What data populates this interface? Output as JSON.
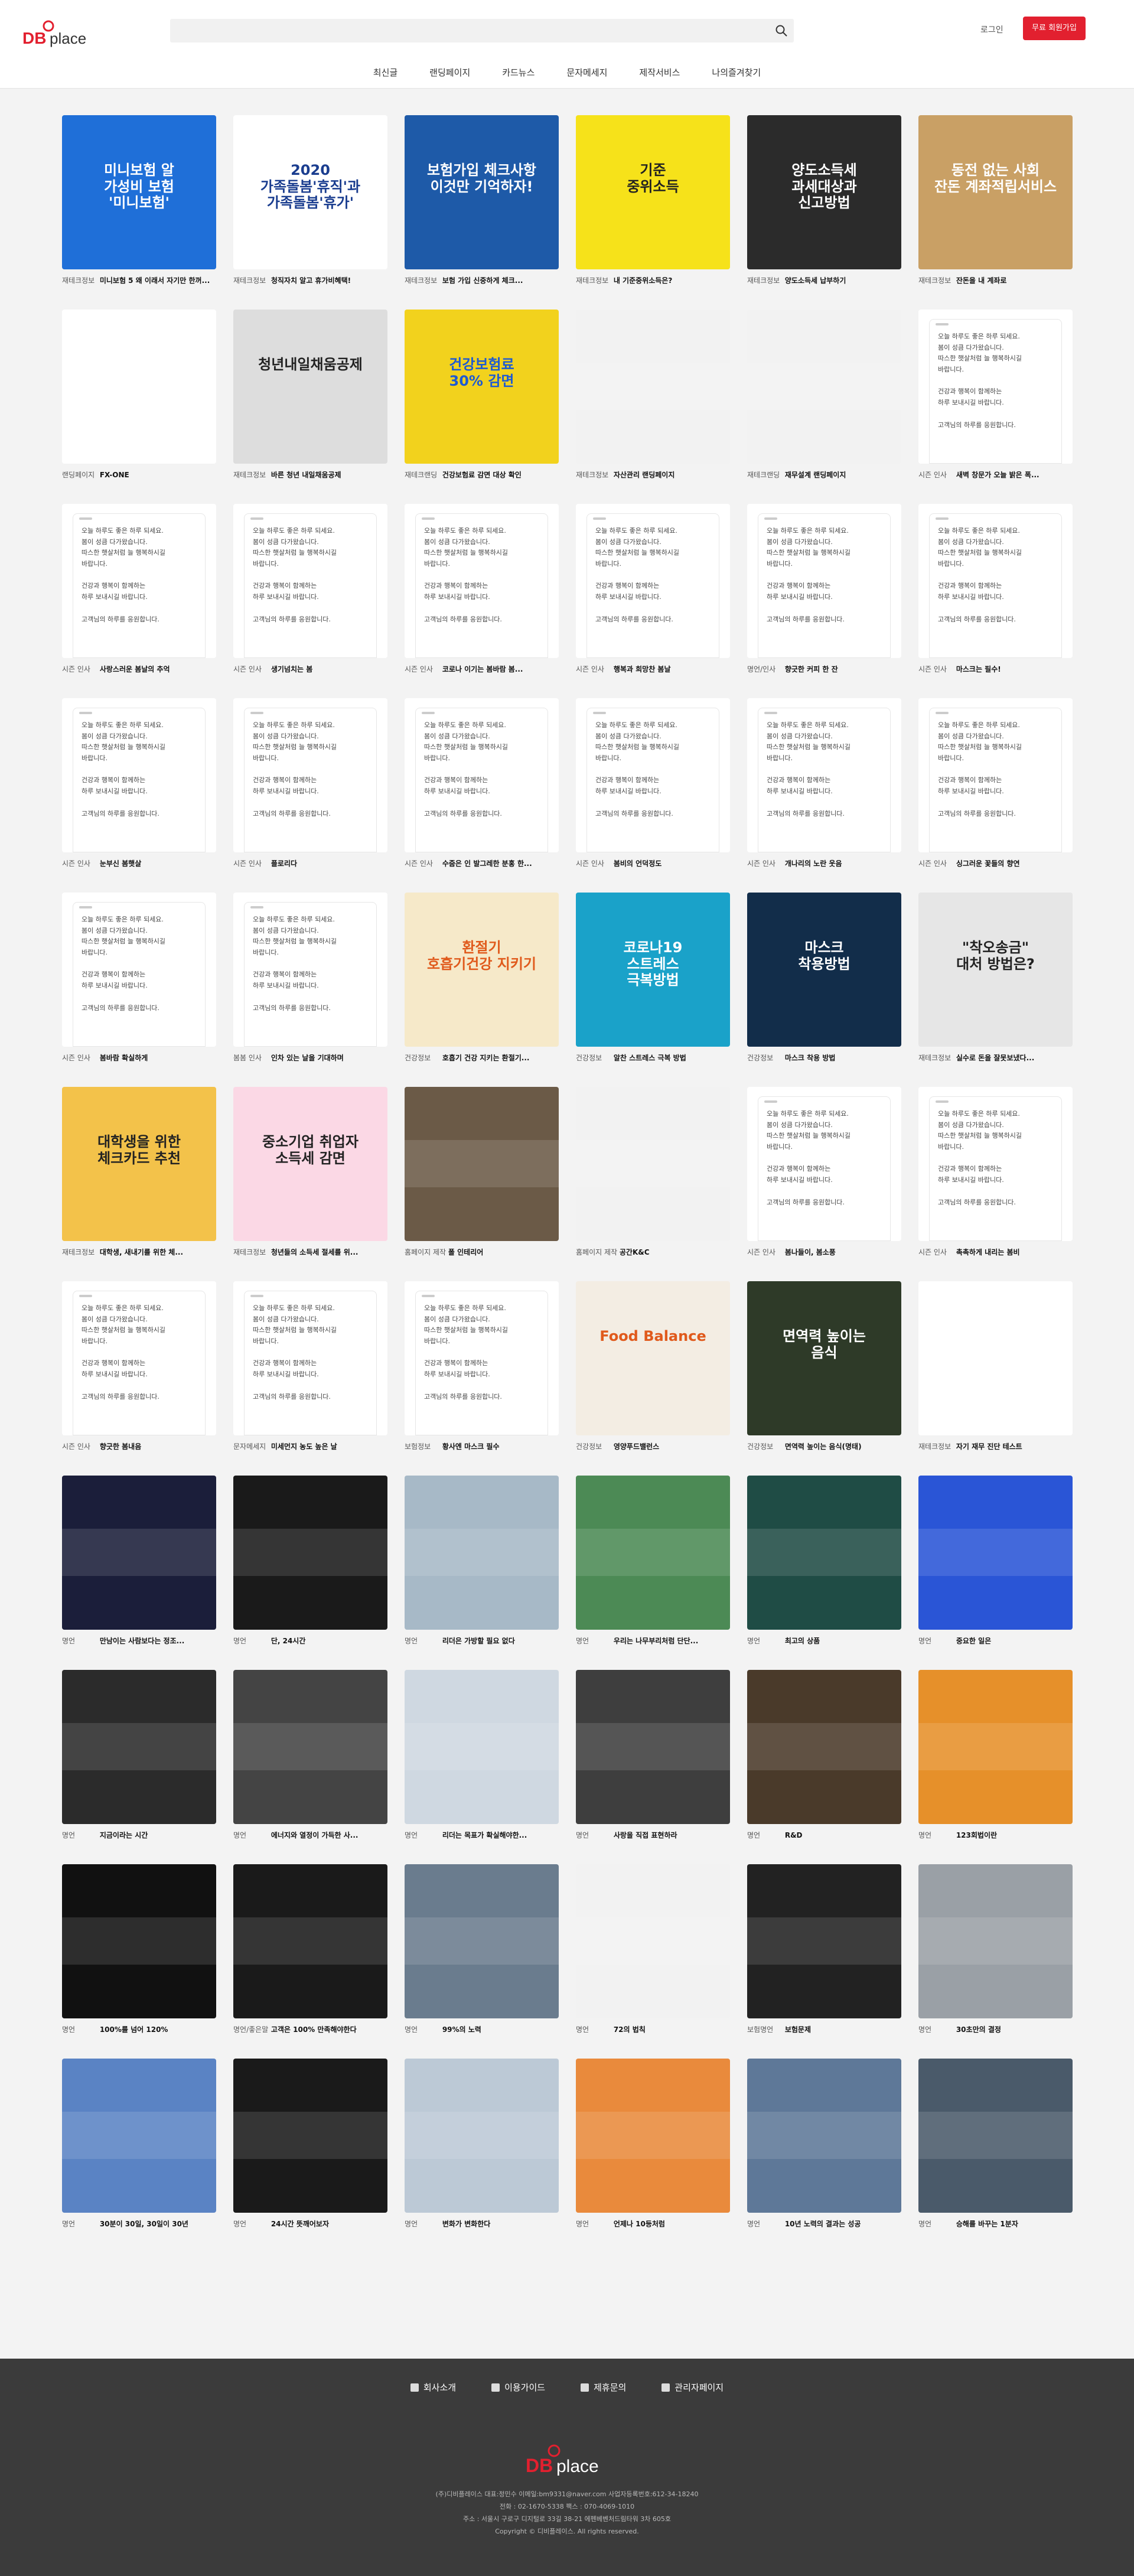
{
  "brand": {
    "logo_db": "DB",
    "logo_place": "place",
    "accent": "#e2202f"
  },
  "search": {
    "placeholder": "",
    "icon": "search-icon"
  },
  "auth": {
    "login": "로그인",
    "join": "무료 회원가입"
  },
  "nav": [
    "최신글",
    "랜딩페이지",
    "카드뉴스",
    "문자메세지",
    "제작서비스",
    "나의즐겨찾기"
  ],
  "cards": [
    {
      "cat": "재테크정보",
      "title": "미니보험 5 왜 이래서 자기만 한꺼...",
      "bg": "#1f6fd8",
      "text": "미니보험 알\n가성비 보험\n'미니보험'",
      "fg": "#fff"
    },
    {
      "cat": "재테크정보",
      "title": "청직자치 알고 휴가비혜택!",
      "bg": "#ffffff",
      "text": "2020\n가족돌봄'휴직'과\n가족돌봄'휴가'",
      "fg": "#1a3d8f"
    },
    {
      "cat": "재테크정보",
      "title": "보험 가입 신중하게 체크...",
      "bg": "#1e5aa8",
      "text": "보험가입 체크사항\n이것만 기억하자!",
      "fg": "#fff"
    },
    {
      "cat": "재테크정보",
      "title": "내 기준중위소득은?",
      "bg": "#f6e21a",
      "text": "기준\n중위소득",
      "fg": "#222"
    },
    {
      "cat": "재테크정보",
      "title": "양도소득세 납부하기",
      "bg": "#2b2b2b",
      "text": "양도소득세\n과세대상과\n신고방법",
      "fg": "#fff"
    },
    {
      "cat": "재테크정보",
      "title": "잔돈을 내 계좌로",
      "bg": "#c9a065",
      "text": "동전 없는 사회\n잔돈 계좌적립서비스",
      "fg": "#fff"
    },
    {
      "cat": "랜딩페이지",
      "title": "FX-ONE",
      "bg": "#ffffff",
      "text": "",
      "fg": "#222"
    },
    {
      "cat": "재테크정보",
      "title": "바른 청년 내일채움공제",
      "bg": "#dddddd",
      "text": "청년내일채움공제",
      "fg": "#222"
    },
    {
      "cat": "재테크랜딩",
      "title": "건강보험료 감면 대상 확인",
      "bg": "#f2d21d",
      "text": "건강보험료\n30% 감면",
      "fg": "#1d5ad3"
    },
    {
      "cat": "재테크정보",
      "title": "자산관리 랜딩페이지",
      "bg": "#f2f2f2",
      "text": "",
      "fg": "#222"
    },
    {
      "cat": "재테크랜딩",
      "title": "재무설계 랜딩페이지",
      "bg": "#f2f2f2",
      "text": "",
      "fg": "#222"
    },
    {
      "cat": "시즌 인사",
      "title": "새벽 창문가 오늘 밝은 폭...",
      "bg": "#ffffff",
      "text": "phone",
      "fg": "#222"
    },
    {
      "cat": "시즌 인사",
      "title": "사랑스러운 봄날의 추억",
      "bg": "#ffffff",
      "text": "phone",
      "fg": "#222"
    },
    {
      "cat": "시즌 인사",
      "title": "생기넘치는 봄",
      "bg": "#ffffff",
      "text": "phone",
      "fg": "#222"
    },
    {
      "cat": "시즌 인사",
      "title": "코로나 이기는 봄바람 봄...",
      "bg": "#ffffff",
      "text": "phone",
      "fg": "#222"
    },
    {
      "cat": "시즌 인사",
      "title": "행복과 희망찬 봄날",
      "bg": "#ffffff",
      "text": "phone",
      "fg": "#222"
    },
    {
      "cat": "명언/인사",
      "title": "향긋한 커피 한 잔",
      "bg": "#ffffff",
      "text": "phone",
      "fg": "#222"
    },
    {
      "cat": "시즌 인사",
      "title": "마스크는 필수!",
      "bg": "#ffffff",
      "text": "phone",
      "fg": "#222"
    },
    {
      "cat": "시즌 인사",
      "title": "눈부신 봄햇살",
      "bg": "#ffffff",
      "text": "phone",
      "fg": "#222"
    },
    {
      "cat": "시즌 인사",
      "title": "플로리다",
      "bg": "#ffffff",
      "text": "phone",
      "fg": "#222"
    },
    {
      "cat": "시즌 인사",
      "title": "수줍은 인 발그레한 분홍 한...",
      "bg": "#ffffff",
      "text": "phone",
      "fg": "#222"
    },
    {
      "cat": "시즌 인사",
      "title": "봄비의 언덕정도",
      "bg": "#ffffff",
      "text": "phone",
      "fg": "#222"
    },
    {
      "cat": "시즌 인사",
      "title": "개나리의 노란 웃음",
      "bg": "#ffffff",
      "text": "phone",
      "fg": "#222"
    },
    {
      "cat": "시즌 인사",
      "title": "싱그러운 꽃들의 향연",
      "bg": "#ffffff",
      "text": "phone",
      "fg": "#222"
    },
    {
      "cat": "시즌 인사",
      "title": "봄바람 확실하게",
      "bg": "#ffffff",
      "text": "phone",
      "fg": "#222"
    },
    {
      "cat": "봄봄 인사",
      "title": "인차 있는 날을 기대하며",
      "bg": "#ffffff",
      "text": "phone",
      "fg": "#222"
    },
    {
      "cat": "건강정보",
      "title": "호흡기 건강 지키는 환절기...",
      "bg": "#f6e9c9",
      "text": "환절기\n호흡기건강 지키기",
      "fg": "#e05a1c"
    },
    {
      "cat": "건강정보",
      "title": "알찬 스트레스 극복 방법",
      "bg": "#1aa2c9",
      "text": "코로나19\n스트레스\n극복방법",
      "fg": "#fff"
    },
    {
      "cat": "건강정보",
      "title": "마스크 착용 방법",
      "bg": "#122d4a",
      "text": "마스크\n착용방법",
      "fg": "#fff"
    },
    {
      "cat": "재테크정보",
      "title": "실수로 돈을 잘못보냈다...",
      "bg": "#e6e6e6",
      "text": "\"착오송금\"\n대처 방법은?",
      "fg": "#222"
    },
    {
      "cat": "재테크정보",
      "title": "대학생, 새내기를 위한 체...",
      "bg": "#f3c24a",
      "text": "대학생을 위한\n체크카드 추천",
      "fg": "#222"
    },
    {
      "cat": "재테크정보",
      "title": "청년들의 소득세 절세를 위...",
      "bg": "#fbd8e5",
      "text": "중소기업 취업자\n소득세 감면",
      "fg": "#222"
    },
    {
      "cat": "홈페이지 제작",
      "title": "폴 인테리어",
      "bg": "#6b5a47",
      "text": "",
      "fg": "#fff"
    },
    {
      "cat": "홈페이지 제작",
      "title": "공간K&C",
      "bg": "#f2f2f2",
      "text": "",
      "fg": "#222"
    },
    {
      "cat": "시즌 인사",
      "title": "봄나들이, 봄소풍",
      "bg": "#ffffff",
      "text": "phone",
      "fg": "#222"
    },
    {
      "cat": "시즌 인사",
      "title": "촉촉하게 내리는 봄비",
      "bg": "#ffffff",
      "text": "phone",
      "fg": "#222"
    },
    {
      "cat": "시즌 인사",
      "title": "향긋한 봄내음",
      "bg": "#ffffff",
      "text": "phone",
      "fg": "#222"
    },
    {
      "cat": "문자메세지",
      "title": "미세먼지 농도 높은 날",
      "bg": "#ffffff",
      "text": "phone",
      "fg": "#222"
    },
    {
      "cat": "보험정보",
      "title": "황사엔 마스크 필수",
      "bg": "#ffffff",
      "text": "phone",
      "fg": "#222"
    },
    {
      "cat": "건강정보",
      "title": "영양푸드밸런스",
      "bg": "#f3ede3",
      "text": "Food Balance",
      "fg": "#e05a1c"
    },
    {
      "cat": "건강정보",
      "title": "면역력 높이는 음식(명태)",
      "bg": "#2e3a28",
      "text": "면역력 높이는\n음식",
      "fg": "#fff"
    },
    {
      "cat": "재테크정보",
      "title": "자기 재무 진단 테스트",
      "bg": "#ffffff",
      "text": "",
      "fg": "#222"
    },
    {
      "cat": "명언",
      "title": "만남이는 사람보다는 정조...",
      "bg": "#1b1e3a",
      "text": "",
      "fg": "#fff"
    },
    {
      "cat": "명언",
      "title": "단, 24시간",
      "bg": "#1a1a1a",
      "text": "",
      "fg": "#fff"
    },
    {
      "cat": "명언",
      "title": "리더은 가방할 필요 없다",
      "bg": "#a7b9c7",
      "text": "",
      "fg": "#fff"
    },
    {
      "cat": "명언",
      "title": "우리는 나무부리처럼 단단...",
      "bg": "#4c8a55",
      "text": "",
      "fg": "#fff"
    },
    {
      "cat": "명언",
      "title": "최고의 상품",
      "bg": "#1f4c45",
      "text": "",
      "fg": "#fff"
    },
    {
      "cat": "명언",
      "title": "중요한 일은",
      "bg": "#2a55d6",
      "text": "",
      "fg": "#fff"
    },
    {
      "cat": "명언",
      "title": "지금이라는 시간",
      "bg": "#2b2b2b",
      "text": "",
      "fg": "#fff"
    },
    {
      "cat": "명언",
      "title": "에너지와 열정이 가득한 사...",
      "bg": "#444444",
      "text": "",
      "fg": "#fff"
    },
    {
      "cat": "명언",
      "title": "리더는 목표가 확실해야한...",
      "bg": "#cfd8e1",
      "text": "",
      "fg": "#fff"
    },
    {
      "cat": "명언",
      "title": "사랑을 직접 표현하라",
      "bg": "#3e3e3e",
      "text": "",
      "fg": "#fff"
    },
    {
      "cat": "명언",
      "title": "R&D",
      "bg": "#4a3a2a",
      "text": "",
      "fg": "#fff"
    },
    {
      "cat": "명언",
      "title": "123회법이란",
      "bg": "#e6902a",
      "text": "",
      "fg": "#fff"
    },
    {
      "cat": "명언",
      "title": "100%를 넘어 120%",
      "bg": "#111111",
      "text": "",
      "fg": "#fff"
    },
    {
      "cat": "명언/좋은말",
      "title": "고객은 100% 만족해야한다",
      "bg": "#1a1a1a",
      "text": "",
      "fg": "#fff"
    },
    {
      "cat": "명언",
      "title": "99%의 노력",
      "bg": "#6a7c8e",
      "text": "",
      "fg": "#fff"
    },
    {
      "cat": "명언",
      "title": "72의 법칙",
      "bg": "#f2f2f2",
      "text": "",
      "fg": "#222"
    },
    {
      "cat": "보험명언",
      "title": "보험문제",
      "bg": "#222222",
      "text": "",
      "fg": "#fff"
    },
    {
      "cat": "명언",
      "title": "30초만의 결정",
      "bg": "#9aa0a6",
      "text": "",
      "fg": "#fff"
    },
    {
      "cat": "명언",
      "title": "30분이 30일, 30일이 30년",
      "bg": "#5a83c4",
      "text": "",
      "fg": "#fff"
    },
    {
      "cat": "명언",
      "title": "24시간 뜻깨어보자",
      "bg": "#1a1a1a",
      "text": "",
      "fg": "#fff"
    },
    {
      "cat": "명언",
      "title": "변화가 변화한다",
      "bg": "#bcc9d6",
      "text": "",
      "fg": "#fff"
    },
    {
      "cat": "명언",
      "title": "언제나 10등처럼",
      "bg": "#e98a3c",
      "text": "",
      "fg": "#fff"
    },
    {
      "cat": "명언",
      "title": "10년 노력의 결과는 성공",
      "bg": "#5e7898",
      "text": "",
      "fg": "#fff"
    },
    {
      "cat": "명언",
      "title": "승해를 바꾸는 1분자",
      "bg": "#4a5a6a",
      "text": "",
      "fg": "#fff"
    }
  ],
  "phone_text": "오늘 하루도 좋은 하루 되세요.\n봄이 성큼 다가왔습니다.\n따스한 햇살처럼 늘 행복하시길\n바랍니다.\n\n건강과 행복이 함께하는\n하루 보내시길 바랍니다.\n\n고객님의 하루를 응원합니다.",
  "footer": {
    "links": [
      "회사소개",
      "이용가이드",
      "제휴문의",
      "관리자페이지"
    ],
    "info": [
      "(주)디비플레이스 대표:정민수 이메일:bm9331@naver.com 사업자등록번호:612-34-18240",
      "전화 : 02-1670-5338 팩스 : 070-4069-1010",
      "주소 : 서울시 구로구 디지털로 33길 38-21 에펜베벤처드림타워 3차 605호",
      "Copyright © 디비플레이스. All rights reserved."
    ]
  }
}
